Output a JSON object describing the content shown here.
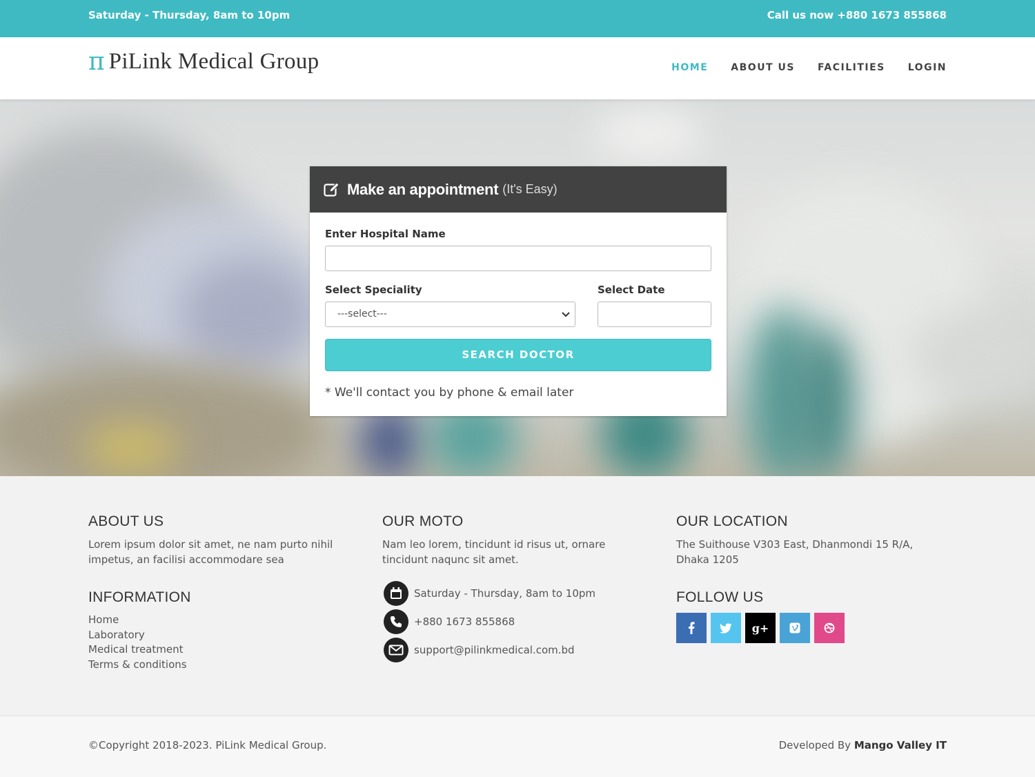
{
  "topbar": {
    "hours": "Saturday - Thursday, 8am to 10pm",
    "call": "Call us now +880 1673 855868"
  },
  "brand": {
    "icon": "π",
    "name": "PiLink Medical Group",
    "accent": "#3fbac2"
  },
  "nav": {
    "home": "HOME",
    "about": "ABOUT US",
    "facilities": "FACILITIES",
    "login": "LOGIN"
  },
  "appointment": {
    "title": "Make an appointment",
    "subtitle": "(It's Easy)",
    "hospital_label": "Enter Hospital Name",
    "hospital_value": "",
    "speciality_label": "Select Speciality",
    "speciality_selected": "---select---",
    "date_label": "Select Date",
    "date_value": "",
    "button": "SEARCH DOCTOR",
    "note": "* We'll contact you by phone & email later"
  },
  "footer": {
    "about_title": "ABOUT US",
    "about_text": "Lorem ipsum dolor sit amet, ne nam purto nihil impetus, an facilisi accommodare sea",
    "info_title": "INFORMATION",
    "info_links": [
      "Home",
      "Laboratory",
      "Medical treatment",
      "Terms & conditions"
    ],
    "moto_title": "OUR MOTO",
    "moto_text": "Nam leo lorem, tincidunt id risus ut, ornare tincidunt naqunc sit amet.",
    "contact_hours": "Saturday - Thursday, 8am to 10pm",
    "contact_phone": "+880 1673 855868",
    "contact_email": "support@pilinkmedical.com.bd",
    "location_title": "OUR LOCATION",
    "location_text": "The Suithouse V303 East, Dhanmondi 15 R/A, Dhaka 1205",
    "follow_title": "FOLLOW US",
    "social": [
      {
        "icon": "facebook-icon",
        "glyph": "f",
        "color": "#3b6db3"
      },
      {
        "icon": "twitter-icon",
        "glyph": "t",
        "color": "#55c5ef"
      },
      {
        "icon": "google-plus-icon",
        "glyph": "g+",
        "color": "#000000"
      },
      {
        "icon": "vimeo-icon",
        "glyph": "v",
        "color": "#4aa3d6"
      },
      {
        "icon": "dribbble-icon",
        "glyph": "d",
        "color": "#e0498a"
      }
    ]
  },
  "bottom": {
    "copyright": "©Copyright 2018-2023. PiLink Medical Group.",
    "developed_prefix": "Developed By",
    "developer": "Mango Valley IT"
  }
}
